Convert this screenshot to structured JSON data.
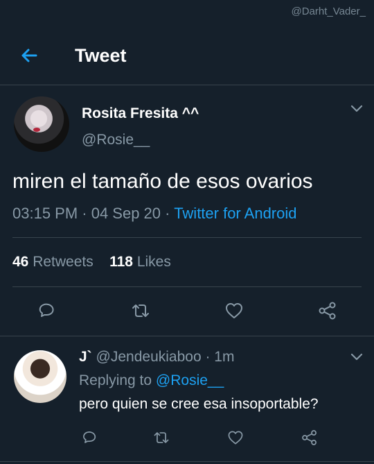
{
  "watermark": "@Darht_Vader_",
  "header": {
    "title": "Tweet",
    "back_icon": "arrow-left-icon"
  },
  "tweet": {
    "name": "Rosita Fresita ^^",
    "handle": "@Rosie__",
    "text": "miren el tamaño de esos ovarios",
    "time": "03:15 PM · 04 Sep 20 ·",
    "source": "Twitter for Android",
    "retweets": "46",
    "retweets_label": "Retweets",
    "likes": "118",
    "likes_label": "Likes",
    "actions": [
      "reply-icon",
      "retweet-icon",
      "like-icon",
      "share-icon"
    ]
  },
  "reply": {
    "name": "J`",
    "handle_time": "@Jendeukiaboo · 1m",
    "replying_prefix": "Replying to",
    "replying_to": "@Rosie__",
    "text": "pero quien se cree esa insoportable?"
  },
  "colors": {
    "background": "#15202b",
    "accent": "#1da1f2",
    "muted": "#8899a6",
    "divider": "#38444d"
  }
}
